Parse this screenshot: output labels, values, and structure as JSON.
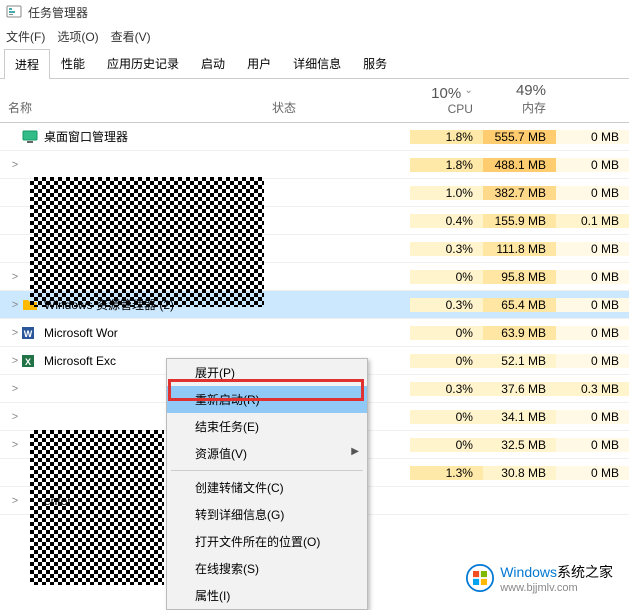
{
  "title": "任务管理器",
  "menubar": [
    "文件(F)",
    "选项(O)",
    "查看(V)"
  ],
  "tabs": [
    "进程",
    "性能",
    "应用历史记录",
    "启动",
    "用户",
    "详细信息",
    "服务"
  ],
  "active_tab": 0,
  "columns": {
    "name": "名称",
    "status": "状态",
    "cpu_pct": "10%",
    "cpu_label": "CPU",
    "mem_pct": "49%",
    "mem_label": "内存",
    "disk_label": ""
  },
  "rows": [
    {
      "expand": "",
      "icon": "dwm",
      "name": "桌面窗口管理器",
      "cpu": "1.8%",
      "mem": "555.7 MB",
      "disk": "0 MB",
      "mem_heat": 4,
      "cpu_heat": 2,
      "disk_heat": 1
    },
    {
      "expand": ">",
      "icon": "",
      "name": "",
      "cpu": "1.8%",
      "mem": "488.1 MB",
      "disk": "0 MB",
      "mem_heat": 4,
      "cpu_heat": 2,
      "disk_heat": 1
    },
    {
      "expand": "",
      "icon": "",
      "name": "",
      "cpu": "1.0%",
      "mem": "382.7 MB",
      "disk": "0 MB",
      "mem_heat": 3,
      "cpu_heat": 1,
      "disk_heat": 1
    },
    {
      "expand": "",
      "icon": "",
      "name": "",
      "cpu": "0.4%",
      "mem": "155.9 MB",
      "disk": "0.1 MB",
      "mem_heat": 2,
      "cpu_heat": 1,
      "disk_heat": 2
    },
    {
      "expand": "",
      "icon": "",
      "name": "",
      "cpu": "0.3%",
      "mem": "111.8 MB",
      "disk": "0 MB",
      "mem_heat": 2,
      "cpu_heat": 1,
      "disk_heat": 1
    },
    {
      "expand": ">",
      "icon": "",
      "name": "",
      "cpu": "0%",
      "mem": "95.8 MB",
      "disk": "0 MB",
      "mem_heat": 2,
      "cpu_heat": 1,
      "disk_heat": 1
    },
    {
      "expand": ">",
      "icon": "explorer",
      "name": "Windows 资源管理器 (2)",
      "cpu": "0.3%",
      "mem": "65.4 MB",
      "disk": "0 MB",
      "mem_heat": 2,
      "cpu_heat": 1,
      "disk_heat": 1,
      "selected": true
    },
    {
      "expand": ">",
      "icon": "word",
      "name": "Microsoft Wor",
      "cpu": "0%",
      "mem": "63.9 MB",
      "disk": "0 MB",
      "mem_heat": 2,
      "cpu_heat": 1,
      "disk_heat": 1
    },
    {
      "expand": ">",
      "icon": "excel",
      "name": "Microsoft Exc",
      "cpu": "0%",
      "mem": "52.1 MB",
      "disk": "0 MB",
      "mem_heat": 1,
      "cpu_heat": 1,
      "disk_heat": 1
    },
    {
      "expand": ">",
      "icon": "",
      "name": "",
      "cpu": "0.3%",
      "mem": "37.6 MB",
      "disk": "0.3 MB",
      "mem_heat": 1,
      "cpu_heat": 1,
      "disk_heat": 2
    },
    {
      "expand": ">",
      "icon": "",
      "name": "",
      "cpu": "0%",
      "mem": "34.1 MB",
      "disk": "0 MB",
      "mem_heat": 1,
      "cpu_heat": 1,
      "disk_heat": 1
    },
    {
      "expand": ">",
      "icon": "",
      "name": "",
      "cpu": "0%",
      "mem": "32.5 MB",
      "disk": "0 MB",
      "mem_heat": 1,
      "cpu_heat": 1,
      "disk_heat": 1
    },
    {
      "expand": "",
      "icon": "",
      "name": "",
      "cpu": "1.3%",
      "mem": "30.8 MB",
      "disk": "0 MB",
      "mem_heat": 1,
      "cpu_heat": 2,
      "disk_heat": 1
    },
    {
      "expand": ">",
      "icon": "",
      "name": "enter",
      "cpu": "",
      "mem": "",
      "disk": "",
      "mem_heat": 0,
      "cpu_heat": 0,
      "disk_heat": 0
    }
  ],
  "context_menu": {
    "items": [
      {
        "label": "展开(P)",
        "hover": false
      },
      {
        "label": "重新启动(R)",
        "hover": true
      },
      {
        "label": "结束任务(E)",
        "hover": false
      },
      {
        "label": "资源值(V)",
        "hover": false,
        "submenu": true
      },
      {
        "sep": true
      },
      {
        "label": "创建转储文件(C)",
        "hover": false
      },
      {
        "label": "转到详细信息(G)",
        "hover": false
      },
      {
        "label": "打开文件所在的位置(O)",
        "hover": false
      },
      {
        "label": "在线搜索(S)",
        "hover": false
      },
      {
        "label": "属性(I)",
        "hover": false
      }
    ]
  },
  "watermark": {
    "brand_blue": "Windows",
    "brand_rest": "系统之家",
    "url": "www.bjjmlv.com"
  }
}
